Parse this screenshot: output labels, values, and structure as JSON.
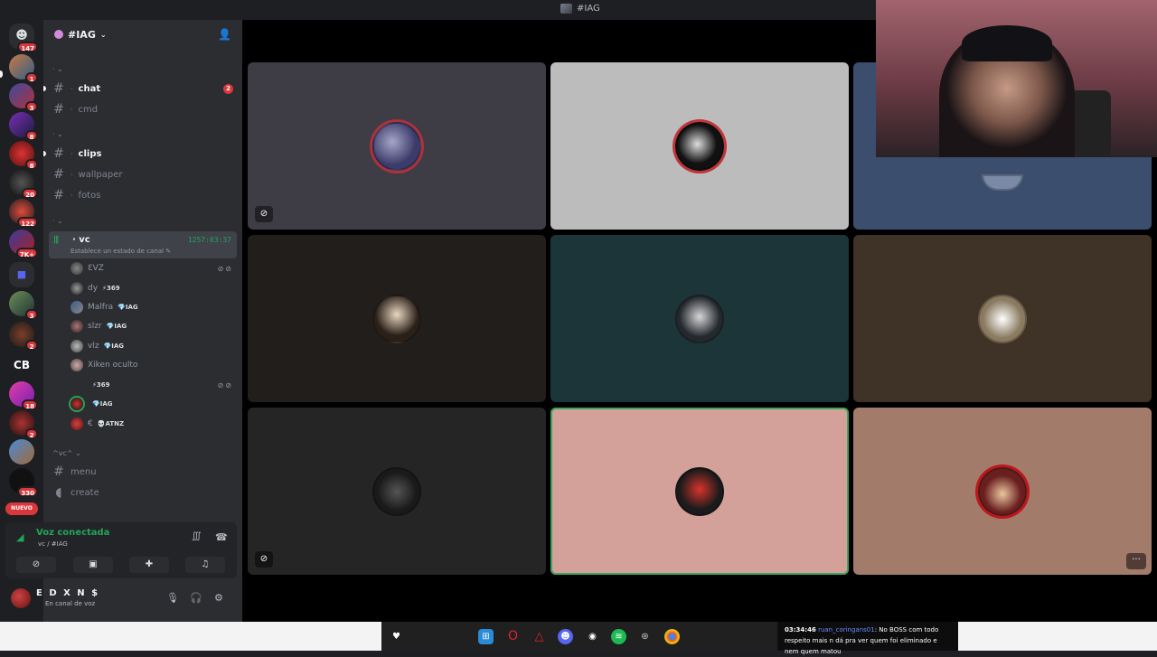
{
  "window": {
    "title": "#IAG"
  },
  "rail": {
    "home_badge": "147",
    "servers": [
      {
        "badge": "1"
      },
      {
        "badge": "3"
      },
      {
        "badge": "8"
      },
      {
        "badge": "8"
      },
      {
        "badge": "20"
      },
      {
        "badge": "122"
      },
      {
        "badge": "7K+"
      },
      {
        "badge": ""
      },
      {
        "badge": "3"
      },
      {
        "badge": "2"
      },
      {
        "badge": "",
        "label": "CB"
      },
      {
        "badge": "18"
      },
      {
        "badge": "2"
      },
      {
        "badge": ""
      },
      {
        "badge": "330"
      }
    ],
    "new_label": "NUEVO"
  },
  "server": {
    "name": "#IAG"
  },
  "channels": {
    "chat": {
      "label": "chat",
      "mentions": "2"
    },
    "cmd": {
      "label": "cmd"
    },
    "clips": {
      "label": "clips"
    },
    "wallpaper": {
      "label": "wallpaper"
    },
    "fotos": {
      "label": "fotos"
    },
    "menu": {
      "label": "menu"
    },
    "create": {
      "label": "create"
    }
  },
  "voice_channel": {
    "name": "vc",
    "elapsed": "1257:03:37",
    "status_prompt": "Establece un estado de canal",
    "members": [
      {
        "name": "ƐVZ",
        "tag": ""
      },
      {
        "name": "dy",
        "tag": "⚡369"
      },
      {
        "name": "Malfra",
        "tag": "💎IAG"
      },
      {
        "name": "slzr",
        "tag": "💎IAG"
      },
      {
        "name": "vlz",
        "tag": "💎IAG"
      },
      {
        "name": "Xiken oculto",
        "tag": ""
      },
      {
        "name": "",
        "tag": "⚡369"
      },
      {
        "name": "",
        "tag": "💎IAG"
      },
      {
        "name": "€",
        "tag": "💀ATNZ"
      }
    ]
  },
  "category_vc": {
    "label": "^vc^"
  },
  "voice_panel": {
    "status": "Voz conectada",
    "location": "vc / #IAG"
  },
  "user": {
    "name": "E D X N $",
    "status": "En canal de voz"
  },
  "stream_chat": {
    "time": "03:34:46",
    "user": "ruan_coringans01",
    "message": ": No BOSS com todo respeito mais n dá pra ver quem foi eliminado e nem quem matou"
  },
  "colors": {
    "accent_green": "#23a559",
    "mention_red": "#da373c",
    "tiles": [
      "#3e3d45",
      "#bcbcbc",
      "#3b4e6e",
      "#211e1c",
      "#1b3538",
      "#3f3226",
      "#252525",
      "#d4a19a",
      "#a27b6b"
    ]
  }
}
